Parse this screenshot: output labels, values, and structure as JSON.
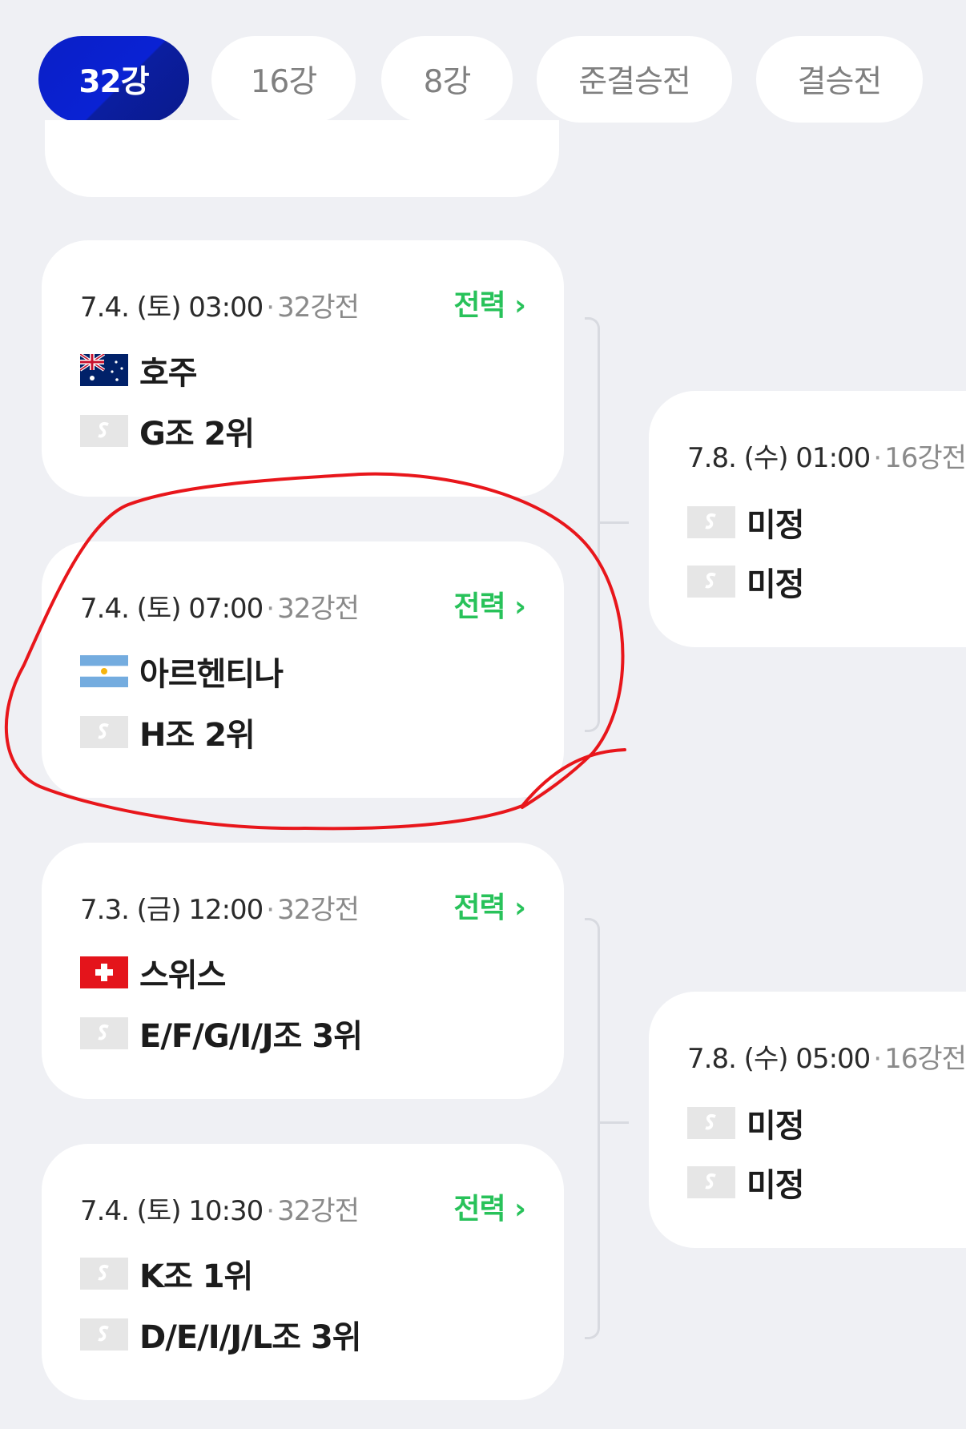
{
  "tabs": [
    {
      "label": "32강",
      "active": true
    },
    {
      "label": "16강",
      "active": false
    },
    {
      "label": "8강",
      "active": false
    },
    {
      "label": "준결승전",
      "active": false
    },
    {
      "label": "결승전",
      "active": false
    }
  ],
  "matches": [
    {
      "date": "7.4. (토) 03:00",
      "round": "32강전",
      "strategy": "전력",
      "team1": {
        "name": "호주",
        "flag": "australia-flag"
      },
      "team2": {
        "name": "G조 2위",
        "flag": "placeholder-flag"
      }
    },
    {
      "date": "7.4. (토) 07:00",
      "round": "32강전",
      "strategy": "전력",
      "team1": {
        "name": "아르헨티나",
        "flag": "argentina-flag"
      },
      "team2": {
        "name": "H조 2위",
        "flag": "placeholder-flag"
      }
    },
    {
      "date": "7.3. (금) 12:00",
      "round": "32강전",
      "strategy": "전력",
      "team1": {
        "name": "스위스",
        "flag": "switzerland-flag"
      },
      "team2": {
        "name": "E/F/G/I/J조 3위",
        "flag": "placeholder-flag"
      }
    },
    {
      "date": "7.4. (토) 10:30",
      "round": "32강전",
      "strategy": "전력",
      "team1": {
        "name": "K조 1위",
        "flag": "placeholder-flag"
      },
      "team2": {
        "name": "D/E/I/J/L조 3위",
        "flag": "placeholder-flag"
      }
    }
  ],
  "next_round": [
    {
      "date": "7.8. (수) 01:00",
      "round": "16강전",
      "team1": {
        "name": "미정"
      },
      "team2": {
        "name": "미정"
      }
    },
    {
      "date": "7.8. (수) 05:00",
      "round": "16강전",
      "team1": {
        "name": "미정"
      },
      "team2": {
        "name": "미정"
      }
    }
  ],
  "colors": {
    "active_tab": "#0a22d4",
    "strategy_green": "#28c25a",
    "annotation_red": "#e8161b",
    "background": "#eff0f4"
  }
}
